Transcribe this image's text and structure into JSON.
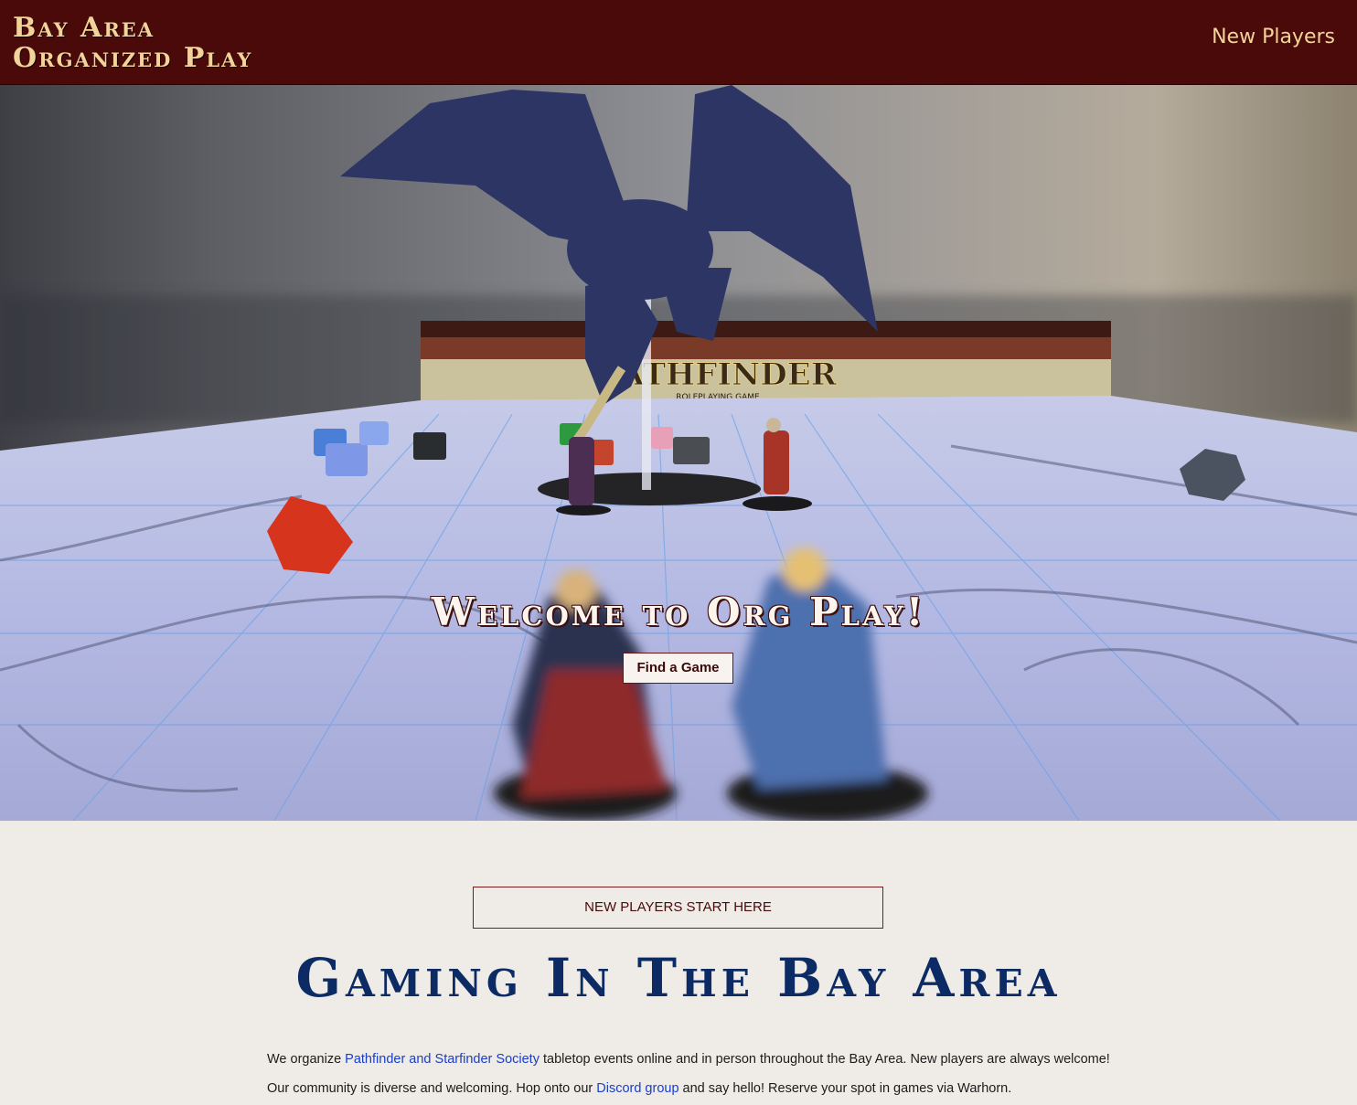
{
  "header": {
    "logo_line1": "Bay Area",
    "logo_line2": "Organized Play",
    "nav_new_players": "New Players"
  },
  "hero": {
    "title": "Welcome to Org Play!",
    "find_game_button": "Find a Game",
    "box_brand": "PATHFINDER",
    "box_subtitle": "ROLEPLAYING GAME"
  },
  "main": {
    "start_button": "NEW PLAYERS START HERE",
    "heading": "Gaming In The Bay Area",
    "p1": {
      "before": "We organize ",
      "link": "Pathfinder and Starfinder Society",
      "after": " tabletop events online and in person throughout the Bay Area. New players are always welcome!"
    },
    "p2": {
      "before": "Our community is diverse and welcoming. Hop onto our ",
      "link": "Discord group",
      "after": " and say hello! Reserve your spot in games via Warhorn."
    }
  },
  "colors": {
    "header_bg": "#4a0a0a",
    "logo_gold": "#f2d49a",
    "heading_navy": "#0c2a63",
    "link_blue": "#1a3fc8",
    "page_bg": "#efebe7"
  },
  "icons": {
    "hero_image": "dragon-miniature-on-battle-map-photo"
  }
}
